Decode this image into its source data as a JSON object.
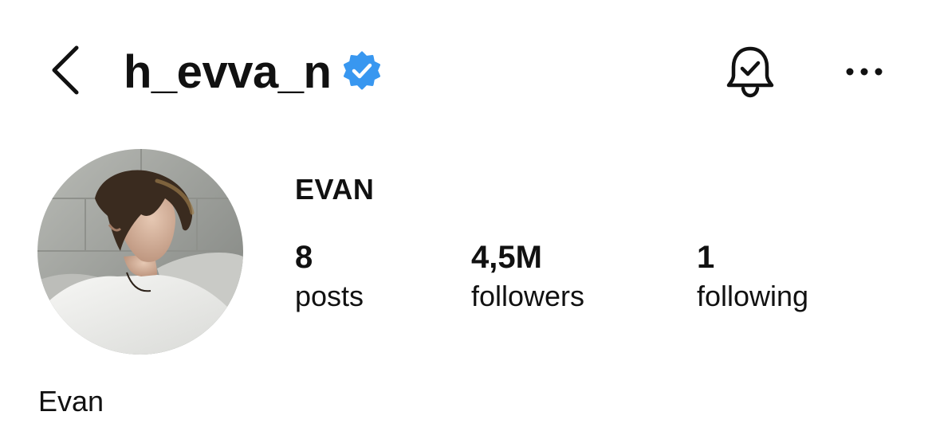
{
  "header": {
    "username": "h_evva_n",
    "verified": true,
    "icons": {
      "back": "chevron-left-icon",
      "verified": "verified-badge-icon",
      "notifications": "bell-check-icon",
      "more": "ellipsis-horizontal-icon"
    }
  },
  "profile": {
    "display_name": "EVAN",
    "avatar": "profile-photo",
    "stats": [
      {
        "value": "8",
        "label": "posts"
      },
      {
        "value": "4,5M",
        "label": "followers"
      },
      {
        "value": "1",
        "label": "following"
      }
    ],
    "bio_name": "Evan"
  },
  "colors": {
    "text": "#111111",
    "verified_blue": "#3897f0",
    "background": "#ffffff"
  }
}
